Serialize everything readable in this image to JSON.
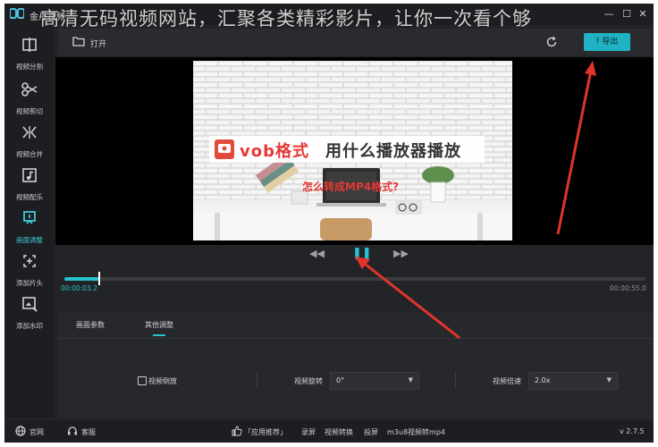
{
  "titlebar": {
    "app_title": "金舟视频",
    "overlay_caption": "高清无码视频网站，汇聚各类精彩影片，让你一次看个够",
    "controls": [
      "—",
      "☐",
      "✕"
    ]
  },
  "sidebar": {
    "items": [
      {
        "label": "视频分割",
        "icon": "video-split-icon"
      },
      {
        "label": "视频剪切",
        "icon": "scissors-icon"
      },
      {
        "label": "视频合并",
        "icon": "merge-icon"
      },
      {
        "label": "视频配乐",
        "icon": "music-icon"
      },
      {
        "label": "画面调整",
        "icon": "crop-adjust-icon",
        "active": true
      },
      {
        "label": "添加片头",
        "icon": "add-intro-icon"
      },
      {
        "label": "添加水印",
        "icon": "watermark-icon"
      }
    ]
  },
  "toolbar": {
    "open_label": "打开",
    "export_label": "导出"
  },
  "preview": {
    "headline_prefix": "vob格式",
    "headline_suffix": "用什么播放器播放",
    "subline": "怎么转成MP4格式?"
  },
  "playback": {
    "progress": 0.06,
    "current_time": "00:00:03.2",
    "total_time": "00:00:55.0"
  },
  "panel": {
    "tabs": [
      {
        "label": "画面参数",
        "active": false
      },
      {
        "label": "其他调整",
        "active": true
      }
    ],
    "reverse_label": "视频倒放",
    "rotate_label": "视频旋转",
    "rotate_value": "0°",
    "speed_label": "视频倍速",
    "speed_value": "2.0x"
  },
  "status": {
    "website_label": "官网",
    "support_label": "客服",
    "recommend_label": "「应用推荐」",
    "links": [
      "录屏",
      "视频转换",
      "投屏",
      "m3u8视频转mp4"
    ],
    "version": "v 2.7.5"
  },
  "colors": {
    "accent": "#27c2d0",
    "background": "#232427",
    "annotation": "#e0342a"
  }
}
